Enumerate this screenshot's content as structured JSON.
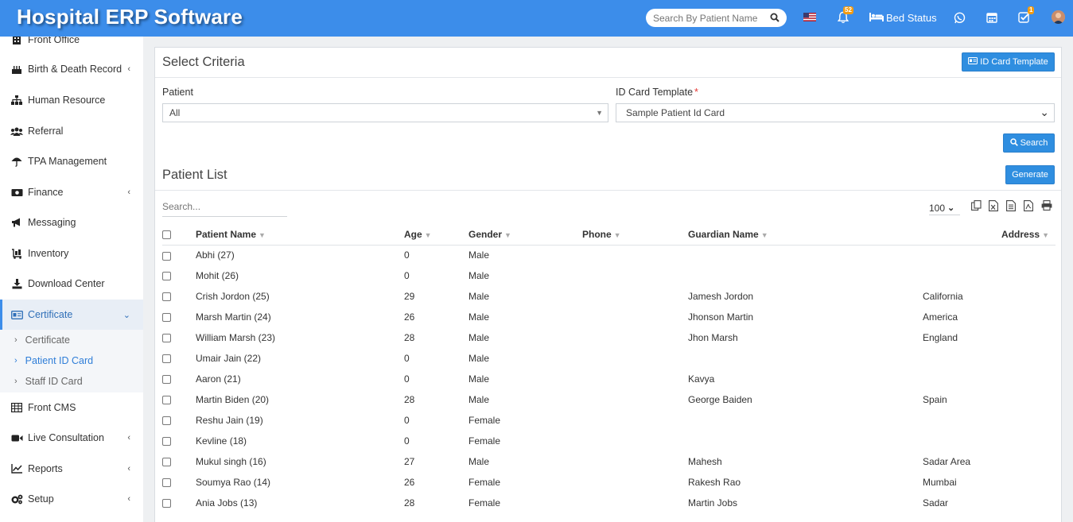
{
  "header": {
    "brand": "Hospital ERP Software",
    "search_placeholder": "Search By Patient Name",
    "notifications_count": "52",
    "bed_status_label": "Bed Status",
    "tasks_count": "1"
  },
  "sidebar": {
    "items": [
      {
        "label": "Front Office"
      },
      {
        "label": "Birth & Death Record"
      },
      {
        "label": "Human Resource"
      },
      {
        "label": "Referral"
      },
      {
        "label": "TPA Management"
      },
      {
        "label": "Finance"
      },
      {
        "label": "Messaging"
      },
      {
        "label": "Inventory"
      },
      {
        "label": "Download Center"
      },
      {
        "label": "Certificate"
      },
      {
        "label": "Front CMS"
      },
      {
        "label": "Live Consultation"
      },
      {
        "label": "Reports"
      },
      {
        "label": "Setup"
      }
    ],
    "sub_items": [
      {
        "label": "Certificate"
      },
      {
        "label": "Patient ID Card"
      },
      {
        "label": "Staff ID Card"
      }
    ]
  },
  "criteria": {
    "title": "Select Criteria",
    "id_card_template_button": "ID Card Template",
    "patient_label": "Patient",
    "patient_value": "All",
    "template_label": "ID Card Template",
    "template_value": "Sample Patient Id Card",
    "search_button": "Search"
  },
  "list": {
    "title": "Patient List",
    "generate_button": "Generate",
    "search_placeholder": "Search...",
    "page_size": "100",
    "columns": {
      "name": "Patient Name",
      "age": "Age",
      "gender": "Gender",
      "phone": "Phone",
      "guardian": "Guardian Name",
      "address": "Address"
    },
    "rows": [
      {
        "name": "Abhi (27)",
        "age": "0",
        "gender": "Male",
        "phone": "",
        "guardian": "",
        "address": ""
      },
      {
        "name": "Mohit (26)",
        "age": "0",
        "gender": "Male",
        "phone": "",
        "guardian": "",
        "address": ""
      },
      {
        "name": "Crish Jordon (25)",
        "age": "29",
        "gender": "Male",
        "phone": "",
        "guardian": "Jamesh Jordon",
        "address": "California"
      },
      {
        "name": "Marsh Martin (24)",
        "age": "26",
        "gender": "Male",
        "phone": "",
        "guardian": "Jhonson Martin",
        "address": "America"
      },
      {
        "name": "William Marsh (23)",
        "age": "28",
        "gender": "Male",
        "phone": "",
        "guardian": "Jhon Marsh",
        "address": "England"
      },
      {
        "name": "Umair Jain (22)",
        "age": "0",
        "gender": "Male",
        "phone": "",
        "guardian": "",
        "address": ""
      },
      {
        "name": "Aaron (21)",
        "age": "0",
        "gender": "Male",
        "phone": "",
        "guardian": "Kavya",
        "address": ""
      },
      {
        "name": "Martin Biden (20)",
        "age": "28",
        "gender": "Male",
        "phone": "",
        "guardian": "George Baiden",
        "address": "Spain"
      },
      {
        "name": "Reshu Jain (19)",
        "age": "0",
        "gender": "Female",
        "phone": "",
        "guardian": "",
        "address": ""
      },
      {
        "name": "Kevline (18)",
        "age": "0",
        "gender": "Female",
        "phone": "",
        "guardian": "",
        "address": ""
      },
      {
        "name": "Mukul singh (16)",
        "age": "27",
        "gender": "Male",
        "phone": "",
        "guardian": "Mahesh",
        "address": "Sadar Area"
      },
      {
        "name": "Soumya Rao (14)",
        "age": "26",
        "gender": "Female",
        "phone": "",
        "guardian": "Rakesh Rao",
        "address": "Mumbai"
      },
      {
        "name": "Ania Jobs (13)",
        "age": "28",
        "gender": "Female",
        "phone": "",
        "guardian": "Martin Jobs",
        "address": "Sadar"
      }
    ]
  },
  "colors": {
    "header": "#3c8dea",
    "button": "#2f8ee0",
    "active": "#2f7ed8"
  }
}
